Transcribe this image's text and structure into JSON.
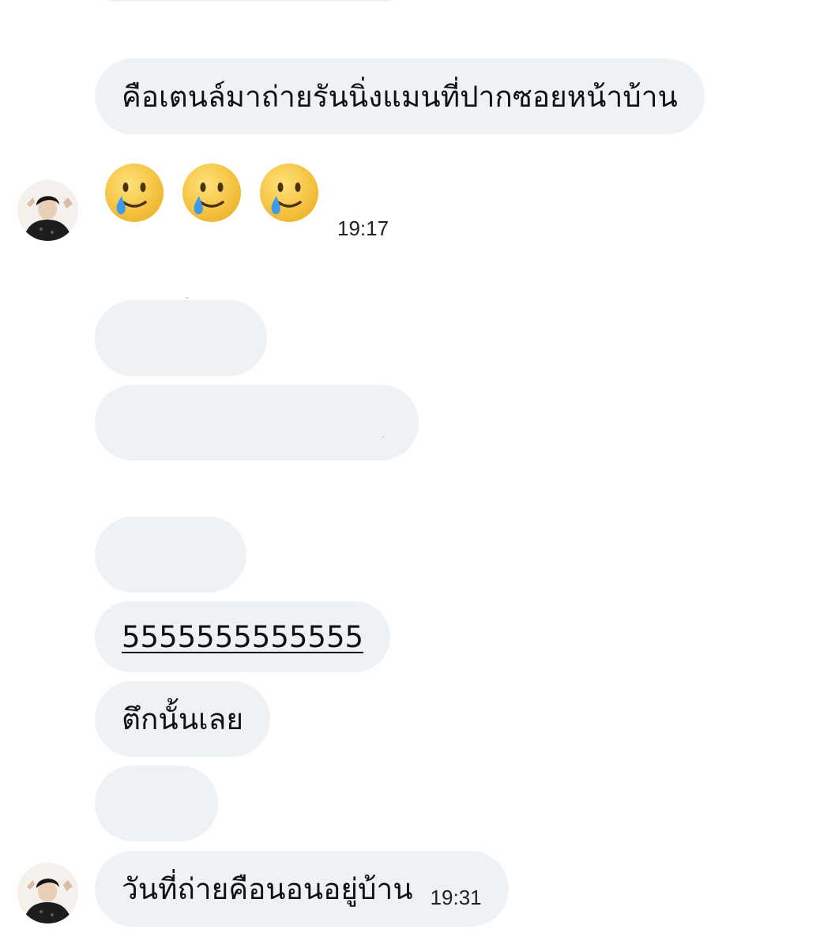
{
  "messages": [
    {
      "text": "คือเตนล์มาถ่ายรันนิ่งแมนที่ปากซอยหน้าบ้าน"
    },
    {
      "emoji": [
        "smiling-face-with-tear",
        "smiling-face-with-tear",
        "smiling-face-with-tear"
      ],
      "time": "19:17"
    },
    {
      "text": "",
      "redacted": true
    },
    {
      "text": "",
      "redacted": true
    },
    {
      "text": "",
      "redacted": true
    },
    {
      "text": "5555555555555",
      "underlined": true
    },
    {
      "text": "ตึกนั้นเลย"
    },
    {
      "text": "",
      "redacted": true
    },
    {
      "text": "วันที่ถ่ายคือนอนอยู่บ้าน",
      "time": "19:31"
    }
  ],
  "colors": {
    "bubble": "#eff2f4",
    "text": "#111111",
    "emoji_face": "#f5c23a",
    "tear": "#3d9be9"
  }
}
